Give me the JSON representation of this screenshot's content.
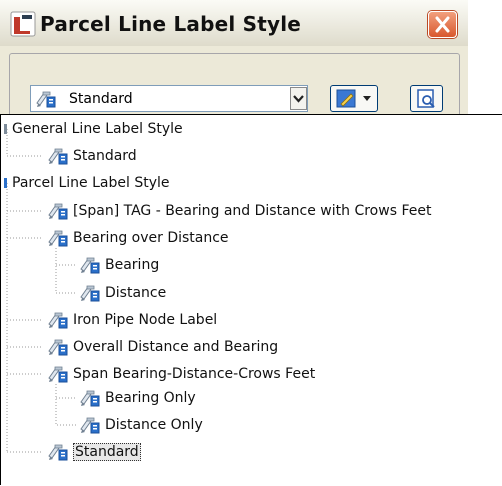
{
  "window": {
    "title": "Parcel Line Label Style"
  },
  "combo": {
    "selected": "Standard"
  },
  "tree": {
    "categories": [
      {
        "label": "General Line Label Style",
        "items": [
          {
            "label": "Standard"
          }
        ]
      },
      {
        "label": "Parcel Line Label Style",
        "items": [
          {
            "label": "[Span] TAG - Bearing and Distance with Crows Feet"
          },
          {
            "label": "Bearing over Distance",
            "children": [
              {
                "label": "Bearing"
              },
              {
                "label": "Distance"
              }
            ]
          },
          {
            "label": "Iron Pipe Node Label"
          },
          {
            "label": "Overall Distance and Bearing"
          },
          {
            "label": "Span Bearing-Distance-Crows Feet",
            "children": [
              {
                "label": "Bearing Only"
              },
              {
                "label": "Distance Only"
              }
            ]
          },
          {
            "label": "Standard",
            "selected": true
          }
        ]
      }
    ]
  },
  "colors": {
    "icon_blue": "#2a6fc9",
    "icon_gray": "#7e8c9a",
    "close_red": "#d9582e"
  }
}
